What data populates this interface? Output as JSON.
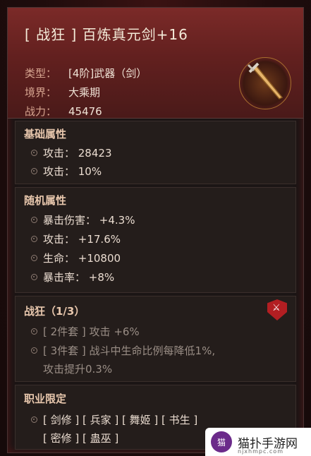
{
  "item": {
    "title": "[ 战狂 ] 百炼真元剑+16",
    "type_key": "类型：",
    "type_val": "[4阶]武器（剑）",
    "realm_key": "境界：",
    "realm_val": "大乘期",
    "power_key": "战力：",
    "power_val": "45476"
  },
  "base": {
    "title": "基础属性",
    "lines": [
      "攻击：  28423",
      "攻击：  10%"
    ]
  },
  "random": {
    "title": "随机属性",
    "lines": [
      "暴击伤害：  +4.3%",
      "攻击：  +17.6%",
      "生命：  +10800",
      "暴击率：  +8%"
    ]
  },
  "set": {
    "title": "战狂（1/3）",
    "lines": [
      "[ 2件套 ] 攻击 +6%",
      "[ 3件套 ] 战斗中生命比例每降低1%,",
      "攻击提升0.3%"
    ]
  },
  "classes": {
    "title": "职业限定",
    "line1": "[ 剑修 ] [ 兵家 ] [ 舞姬 ] [ 书生 ]",
    "line2": "[ 密修 ] [ 蛊巫 ]"
  },
  "watermark": {
    "text": "猫扑手游网",
    "sub": "njxhmpc.com"
  }
}
